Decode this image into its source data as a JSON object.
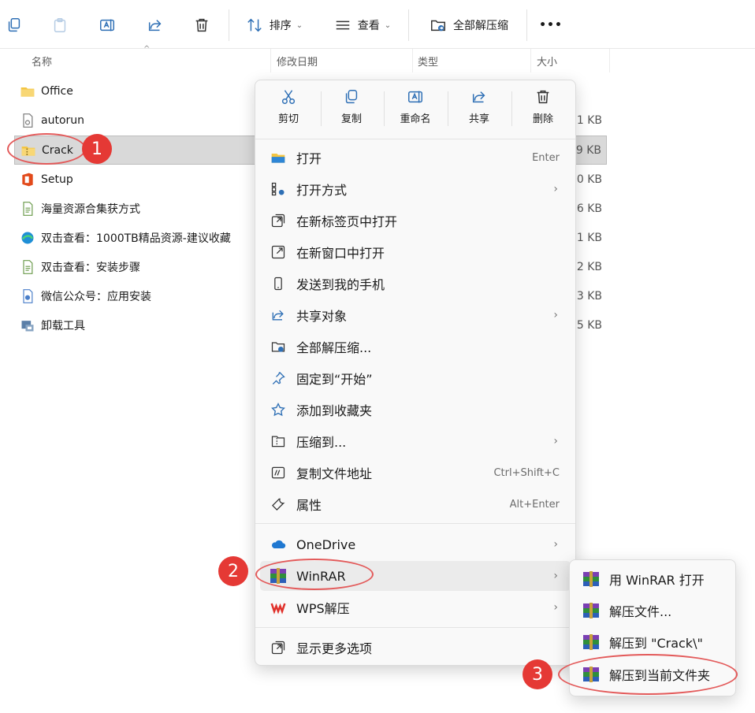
{
  "toolbar": {
    "sort_label": "排序",
    "view_label": "查看",
    "extract_all_label": "全部解压缩",
    "more_label": "•••"
  },
  "columns": {
    "name": "名称",
    "modified": "修改日期",
    "type": "类型",
    "size": "大小"
  },
  "files": [
    {
      "name": "Office",
      "size": ""
    },
    {
      "name": "autorun",
      "size": "1 KB"
    },
    {
      "name": "Crack",
      "size": "9 KB"
    },
    {
      "name": "Setup",
      "size": "0 KB"
    },
    {
      "name": "海量资源合集获方式",
      "size": "6 KB"
    },
    {
      "name": "双击查看：1000TB精品资源-建议收藏",
      "size": "1 KB"
    },
    {
      "name": "双击查看：安装步骤",
      "size": "2 KB"
    },
    {
      "name": "微信公众号：应用安装",
      "size": "3 KB"
    },
    {
      "name": "卸载工具",
      "size": "5 KB"
    }
  ],
  "context_menu": {
    "quick_actions": {
      "cut": "剪切",
      "copy": "复制",
      "rename": "重命名",
      "share": "共享",
      "delete": "删除"
    },
    "items": {
      "open": "打开",
      "open_shortcut": "Enter",
      "open_with": "打开方式",
      "open_new_tab": "在新标签页中打开",
      "open_new_window": "在新窗口中打开",
      "send_to_phone": "发送到我的手机",
      "share_to": "共享对象",
      "extract_all": "全部解压缩...",
      "pin_start": "固定到“开始”",
      "add_favorites": "添加到收藏夹",
      "compress_to": "压缩到...",
      "copy_path": "复制文件地址",
      "copy_path_shortcut": "Ctrl+Shift+C",
      "properties": "属性",
      "properties_shortcut": "Alt+Enter",
      "onedrive": "OneDrive",
      "winrar": "WinRAR",
      "wps": "WPS解压",
      "more_options": "显示更多选项"
    }
  },
  "winrar_submenu": {
    "open_with_winrar": "用 WinRAR 打开",
    "extract_files": "解压文件...",
    "extract_to_crack": "解压到 \"Crack\\\"",
    "extract_here": "解压到当前文件夹"
  },
  "annotations": {
    "step1": "1",
    "step2": "2",
    "step3": "3"
  },
  "colors": {
    "accent": "#0067c0",
    "badge": "#e53935",
    "ring": "#e35a5a",
    "folder": "#f4c542"
  }
}
